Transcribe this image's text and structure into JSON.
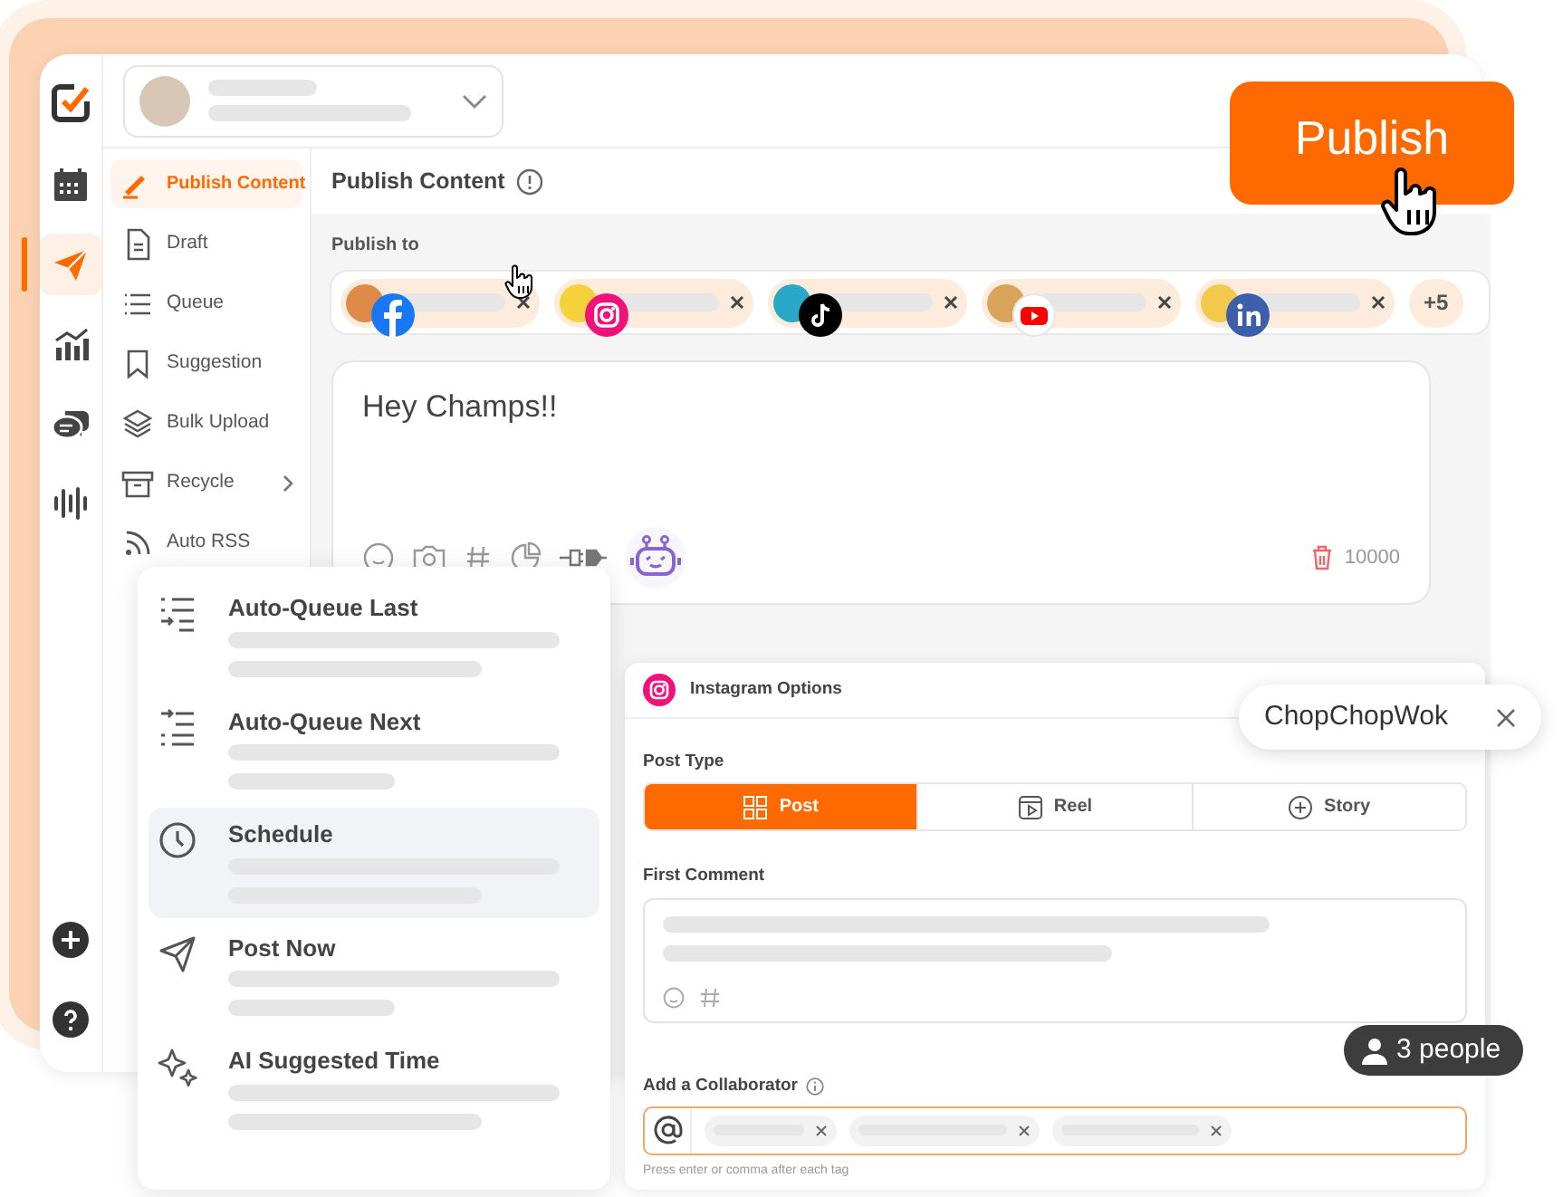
{
  "rail": [
    {
      "selected": false
    },
    {
      "selected": true
    },
    {
      "selected": false
    },
    {
      "selected": false
    },
    {
      "selected": false
    }
  ],
  "nav": [
    {
      "label": "Publish Content",
      "selected": true,
      "submenu": false
    },
    {
      "label": "Draft",
      "selected": false,
      "submenu": false
    },
    {
      "label": "Queue",
      "selected": false,
      "submenu": false
    },
    {
      "label": "Suggestion",
      "selected": false,
      "submenu": false
    },
    {
      "label": "Bulk Upload",
      "selected": false,
      "submenu": false
    },
    {
      "label": "Recycle",
      "selected": false,
      "submenu": true
    },
    {
      "label": "Auto RSS",
      "selected": false,
      "submenu": false
    }
  ],
  "content": {
    "title": "Publish Content",
    "publish_to": "Publish to",
    "channels": [
      {
        "kind": "facebook"
      },
      {
        "kind": "instagram"
      },
      {
        "kind": "tiktok"
      },
      {
        "kind": "youtube"
      },
      {
        "kind": "linkedin"
      }
    ],
    "more": "+5",
    "editor": {
      "text": "Hey Champs!!",
      "counter": "10000"
    }
  },
  "publish_button": "Publish",
  "schedule_menu": [
    {
      "label": "Auto-Queue Last",
      "selected": false
    },
    {
      "label": "Auto-Queue Next",
      "selected": false
    },
    {
      "label": "Schedule",
      "selected": true
    },
    {
      "label": "Post Now",
      "selected": false
    },
    {
      "label": "AI Suggested Time",
      "selected": false
    }
  ],
  "instagram_options": {
    "title": "Instagram Options",
    "post_type_label": "Post Type",
    "post_types": [
      {
        "label": "Post",
        "selected": true
      },
      {
        "label": "Reel",
        "selected": false
      },
      {
        "label": "Story",
        "selected": false
      }
    ],
    "first_comment_label": "First Comment",
    "collaborator_label": "Add a Collaborator",
    "hint": "Press enter or comma after each tag"
  },
  "account_chip": "ChopChopWok",
  "people_badge": "3 people"
}
